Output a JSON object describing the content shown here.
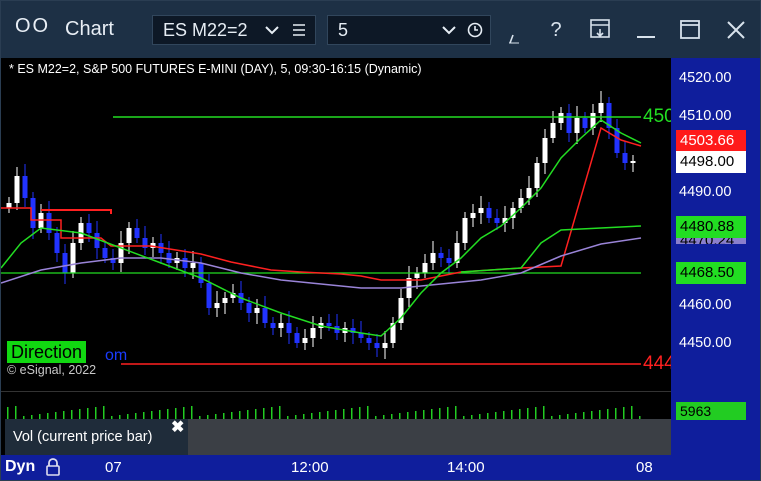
{
  "window": {
    "title": "Chart",
    "symbol": "ES M22=2",
    "interval": "5"
  },
  "chart": {
    "subtitle": "* ES M22=2, S&P 500 FUTURES E-MINI (DAY), 5, 09:30-16:15 (Dynamic)",
    "y_ticks": [
      "4520.00",
      "4510.00",
      "4490.00",
      "4460.00",
      "4450.00"
    ],
    "price_tags": [
      {
        "value": "4503.66",
        "bg": "#ff1a1a",
        "fg": "#ffffff"
      },
      {
        "value": "4498.00",
        "bg": "#ffffff",
        "fg": "#000000"
      },
      {
        "value": "4480.88",
        "bg": "#22dd22",
        "fg": "#000000"
      },
      {
        "value": "4470.24",
        "bg": "#8a7fcc",
        "fg": "#000000"
      },
      {
        "value": "4468.50",
        "bg": "#22dd22",
        "fg": "#000000"
      }
    ],
    "line_labels": {
      "green": "450",
      "red": "444"
    },
    "direction_label": "Direction",
    "partial_text": "om",
    "copyright": "© eSignal, 2022",
    "x_ticks": [
      "07",
      "12:00",
      "14:00",
      "08"
    ],
    "dyn_label": "Dyn"
  },
  "volume": {
    "label": "Vol (current price bar)",
    "value": "5963"
  },
  "colors": {
    "up": "#ffffff",
    "down": "#2233ff",
    "line_green": "#22dd22",
    "line_red": "#ff2020",
    "line_purple": "#9a84d8",
    "axis_bg": "#0f1e9c"
  },
  "icons": [
    "chevron-down-icon",
    "list-icon",
    "clock-icon",
    "pen-icon",
    "help-icon",
    "save-icon",
    "minimize-icon",
    "maximize-icon",
    "close-icon",
    "lock-icon"
  ]
}
